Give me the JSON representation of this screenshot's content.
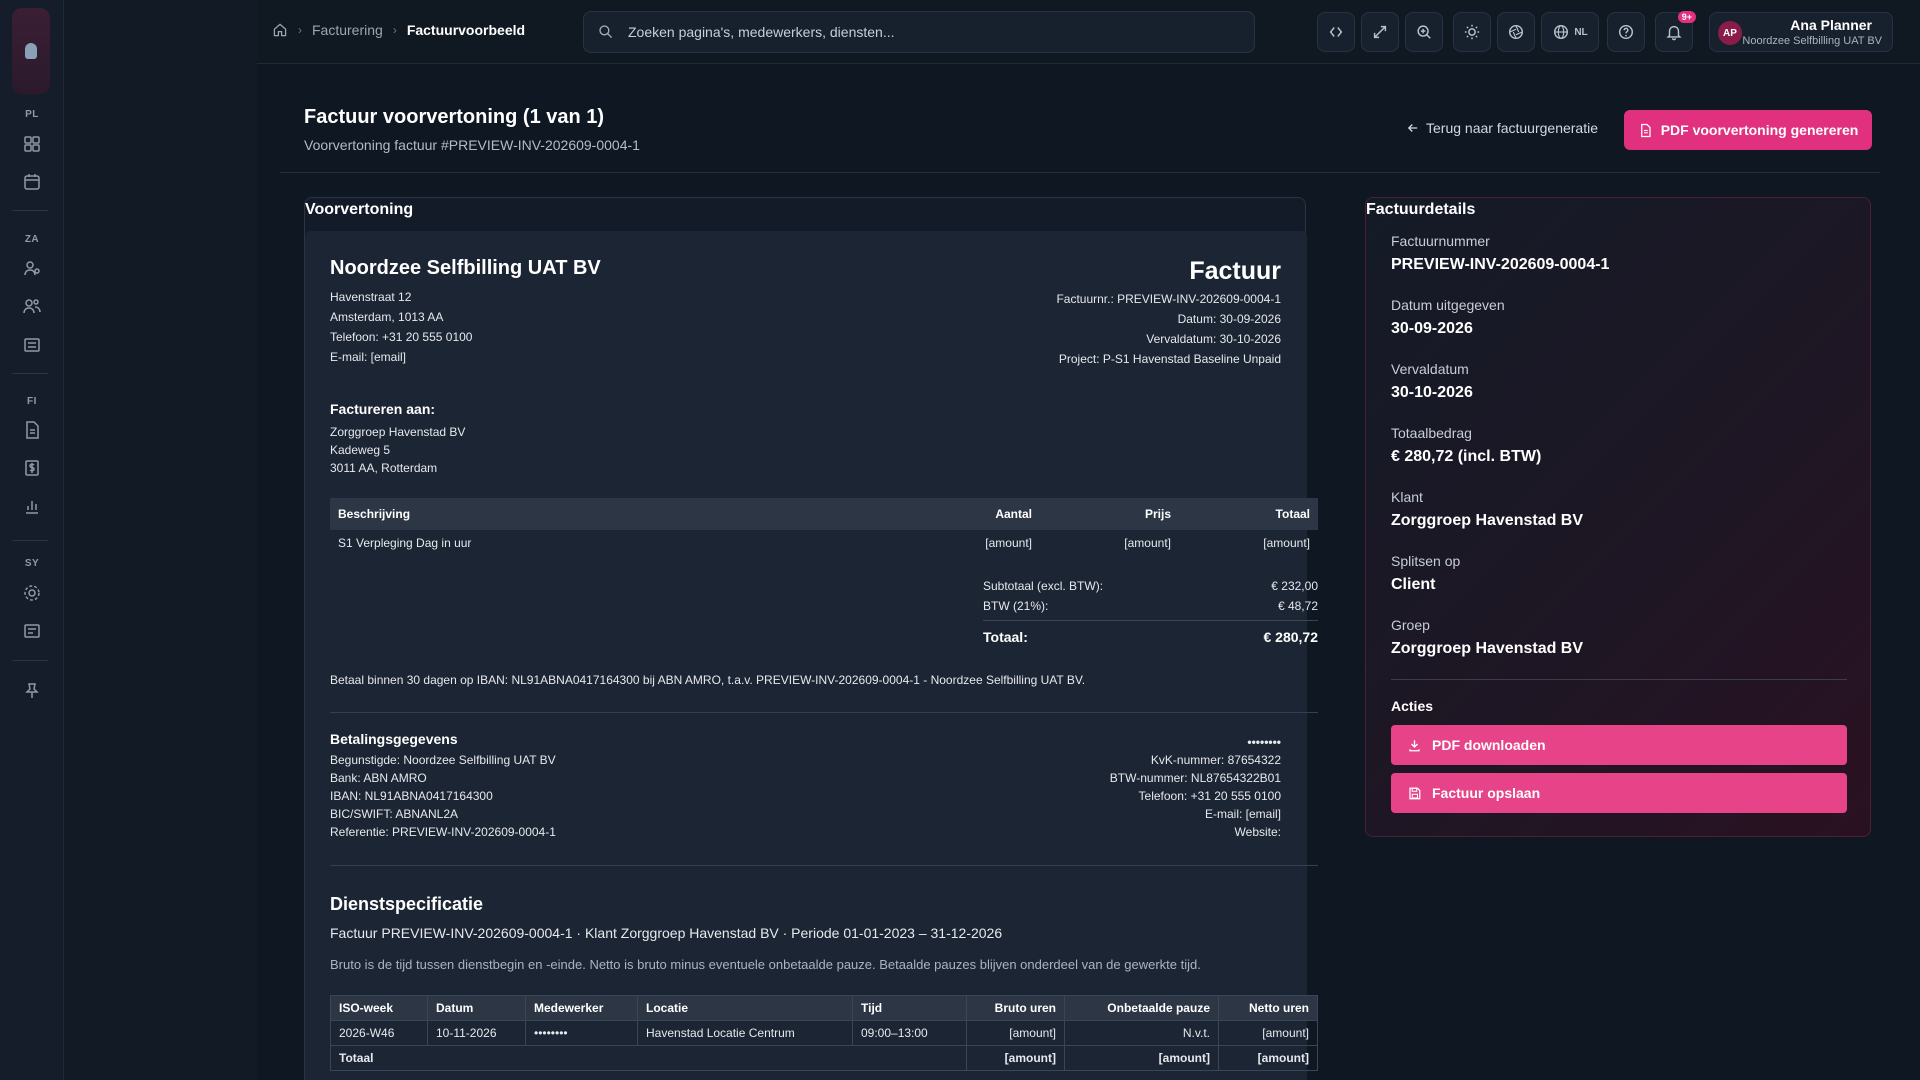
{
  "topbar": {
    "breadcrumbs": [
      "Facturering",
      "Factuurvoorbeeld"
    ],
    "search_placeholder": "Zoeken pagina's, medewerkers, diensten...",
    "language": "NL",
    "notifications_badge": "9+",
    "user": {
      "initials": "AP",
      "name": "Ana Planner",
      "org": "Noordzee Selfbilling UAT BV"
    }
  },
  "sidebar": {
    "sections": [
      "PL",
      "ZA",
      "FI",
      "SY"
    ],
    "icons": [
      "dashboard-icon",
      "calendar-icon",
      "user-settings-icon",
      "users-icon",
      "building-icon",
      "document-icon",
      "money-icon",
      "chart-icon",
      "gear-icon",
      "receipt-icon",
      "pin-icon"
    ]
  },
  "page": {
    "title": "Factuur voorvertoning (1 van 1)",
    "subtitle": "Voorvertoning factuur #PREVIEW-INV-202609-0004-1",
    "back_label": "Terug naar factuurgeneratie",
    "generate_label": "PDF voorvertoning genereren",
    "preview_label": "Voorvertoning"
  },
  "invoice": {
    "company": "Noordzee Selfbilling UAT BV",
    "address": [
      "Havenstraat 12",
      "Amsterdam, 1013 AA",
      "Telefoon: +31 20 555 0100",
      "E-mail: [email]"
    ],
    "heading": "Factuur",
    "meta": [
      "Factuurnr.: PREVIEW-INV-202609-0004-1",
      "Datum: 30-09-2026",
      "Vervaldatum: 30-10-2026",
      "Project: P-S1 Havenstad Baseline Unpaid"
    ],
    "bill_to_heading": "Factureren aan:",
    "bill_to": [
      "Zorggroep Havenstad BV",
      "Kadeweg 5",
      "3011 AA, Rotterdam"
    ],
    "items_headers": [
      "Beschrijving",
      "Aantal",
      "Prijs",
      "Totaal"
    ],
    "items": [
      [
        "S1 Verpleging Dag in uur",
        "[amount]",
        "[amount]",
        "[amount]"
      ]
    ],
    "subtotal_label": "Subtotaal (excl. BTW):",
    "subtotal": "€ 232,00",
    "vat_label": "BTW (21%):",
    "vat": "€ 48,72",
    "total_label": "Totaal:",
    "total": "€ 280,72",
    "payment_line": "Betaal binnen 30 dagen op IBAN: NL91ABNA0417164300 bij ABN AMRO, t.a.v. PREVIEW-INV-202609-0004-1 - Noordzee Selfbilling UAT BV.",
    "payment_heading": "Betalingsgegevens",
    "payment_left": [
      "Begunstigde: Noordzee Selfbilling UAT BV",
      "Bank: ABN AMRO",
      "IBAN: NL91ABNA0417164300",
      "BIC/SWIFT: ABNANL2A",
      "Referentie: PREVIEW-INV-202609-0004-1"
    ],
    "payment_right_masked": "••••••••",
    "payment_right": [
      "KvK-nummer: 87654322",
      "BTW-nummer: NL87654322B01",
      "Telefoon: +31 20 555 0100",
      "E-mail: [email]",
      "Website:"
    ],
    "spec_heading": "Dienstspecificatie",
    "spec_subtitle": "Factuur PREVIEW-INV-202609-0004-1 · Klant Zorggroep Havenstad BV · Periode 01-01-2023 – 31-12-2026",
    "spec_note": "Bruto is de tijd tussen dienstbegin en -einde. Netto is bruto minus eventuele onbetaalde pauze. Betaalde pauzes blijven onderdeel van de gewerkte tijd.",
    "spec_headers": [
      "ISO-week",
      "Datum",
      "Medewerker",
      "Locatie",
      "Tijd",
      "Bruto uren",
      "Onbetaalde pauze",
      "Netto uren"
    ],
    "spec_rows": [
      [
        "2026-W46",
        "10-11-2026",
        "••••••••",
        "Havenstad Locatie Centrum",
        "09:00–13:00",
        "[amount]",
        "N.v.t.",
        "[amount]"
      ]
    ],
    "spec_total": [
      "Totaal",
      "[amount]",
      "[amount]",
      "[amount]"
    ]
  },
  "details": {
    "heading": "Factuurdetails",
    "fields": [
      {
        "label": "Factuurnummer",
        "value": "PREVIEW-INV-202609-0004-1"
      },
      {
        "label": "Datum uitgegeven",
        "value": "30-09-2026"
      },
      {
        "label": "Vervaldatum",
        "value": "30-10-2026"
      },
      {
        "label": "Totaalbedrag",
        "value": "€ 280,72 (incl. BTW)"
      },
      {
        "label": "Klant",
        "value": "Zorggroep Havenstad BV"
      },
      {
        "label": "Splitsen op",
        "value": "Client"
      },
      {
        "label": "Groep",
        "value": "Zorggroep Havenstad BV"
      }
    ],
    "actions_heading": "Acties",
    "download_label": "PDF downloaden",
    "save_label": "Factuur opslaan"
  },
  "colors": {
    "accent": "#e0307e",
    "background": "#0f1722",
    "paper": "#1c2533"
  }
}
